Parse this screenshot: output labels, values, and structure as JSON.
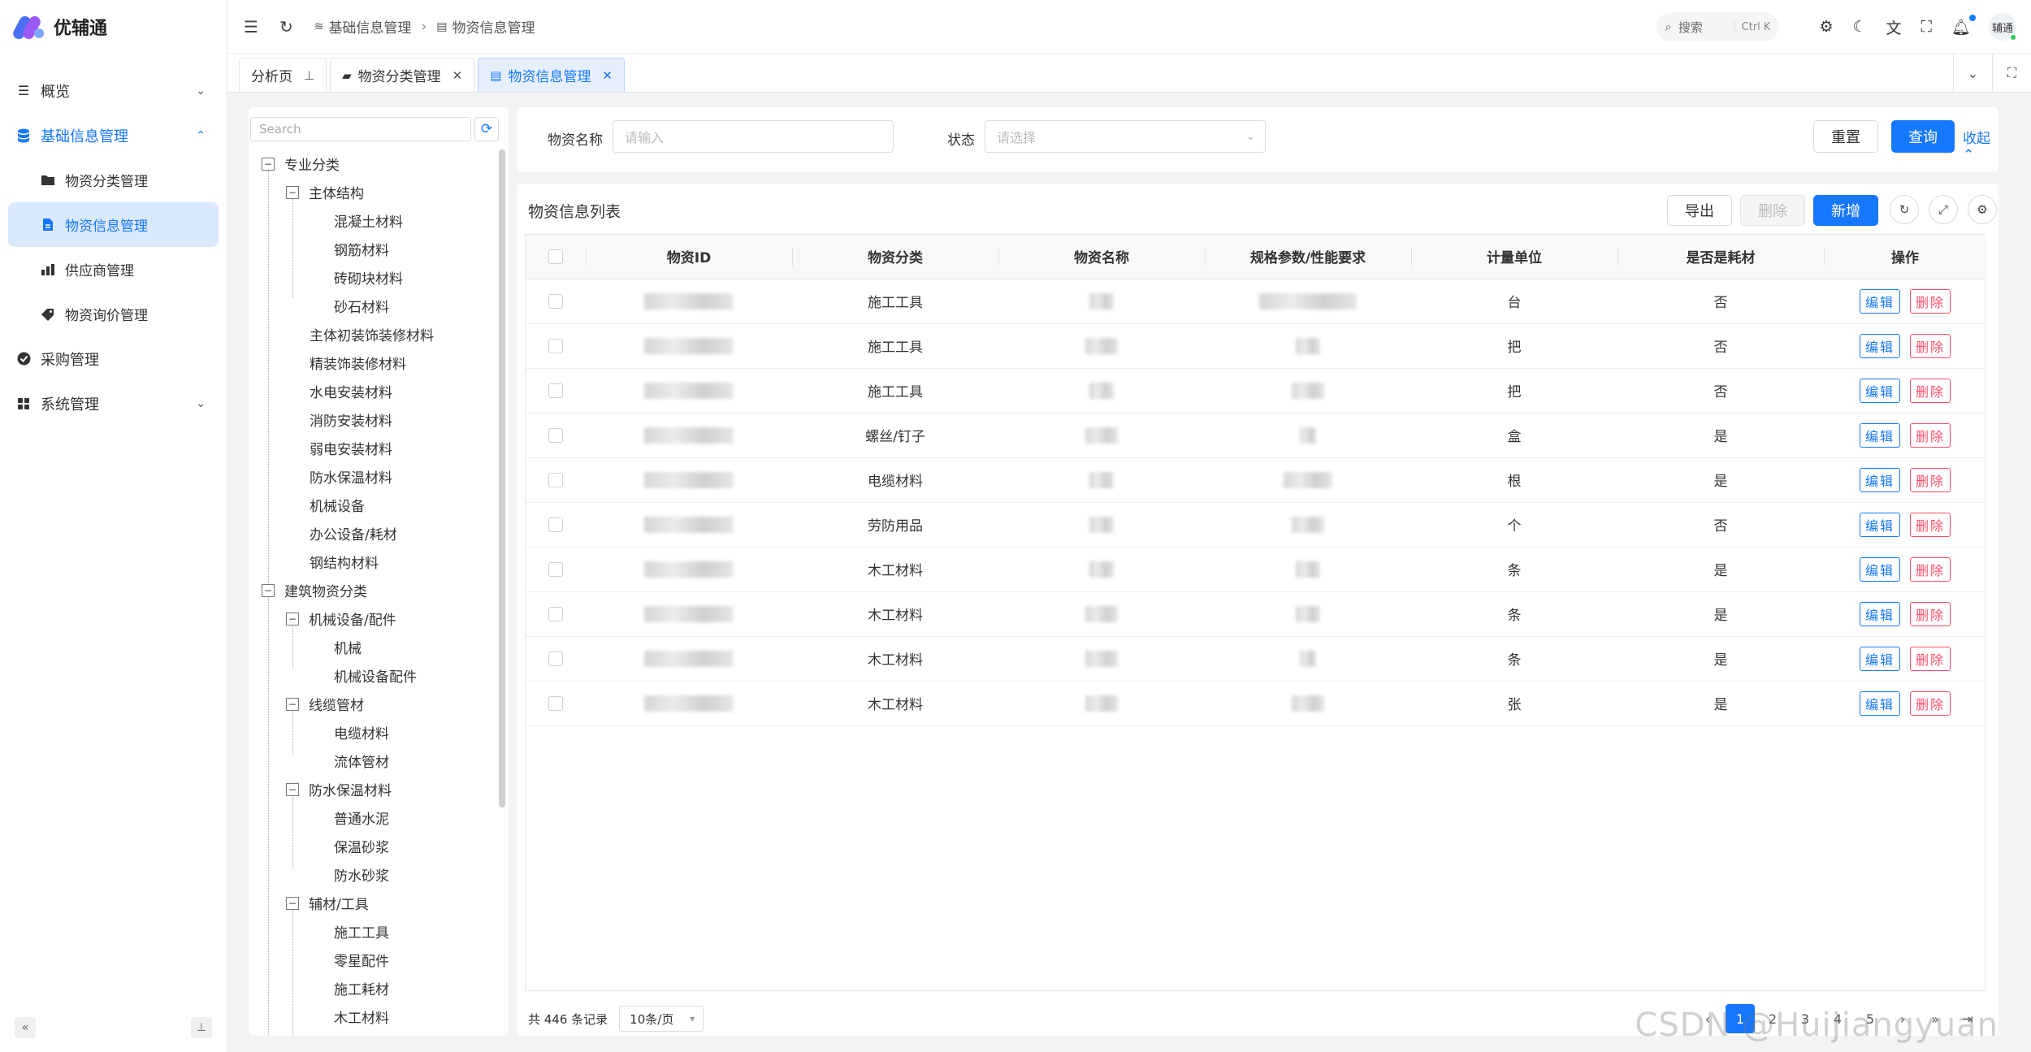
{
  "app": {
    "name": "优辅通"
  },
  "sidebar": {
    "items": [
      {
        "label": "概览",
        "icon": "list-icon"
      },
      {
        "label": "基础信息管理",
        "icon": "database-icon"
      },
      {
        "label": "物资分类管理",
        "icon": "folder-icon"
      },
      {
        "label": "物资信息管理",
        "icon": "file-icon"
      },
      {
        "label": "供应商管理",
        "icon": "chart-icon"
      },
      {
        "label": "物资询价管理",
        "icon": "tag-icon"
      },
      {
        "label": "采购管理",
        "icon": "check-circle-icon"
      },
      {
        "label": "系统管理",
        "icon": "grid-icon"
      }
    ]
  },
  "header": {
    "breadcrumb": [
      "基础信息管理",
      "物资信息管理"
    ],
    "search_label": "搜索",
    "search_shortcut": "Ctrl K",
    "user": "辅通"
  },
  "tabs": [
    {
      "label": "分析页"
    },
    {
      "label": "物资分类管理"
    },
    {
      "label": "物资信息管理"
    }
  ],
  "tree": {
    "search_placeholder": "Search",
    "nodes": [
      "专业分类",
      "主体结构",
      "混凝土材料",
      "钢筋材料",
      "砖砌块材料",
      "砂石材料",
      "主体初装饰装修材料",
      "精装饰装修材料",
      "水电安装材料",
      "消防安装材料",
      "弱电安装材料",
      "防水保温材料",
      "机械设备",
      "办公设备/耗材",
      "钢结构材料",
      "建筑物资分类",
      "机械设备/配件",
      "机械",
      "机械设备配件",
      "线缆管材",
      "电缆材料",
      "流体管材",
      "防水保温材料",
      "普通水泥",
      "保温砂浆",
      "防水砂浆",
      "辅材/工具",
      "施工工具",
      "零星配件",
      "施工耗材",
      "木工材料"
    ]
  },
  "filter": {
    "name_label": "物资名称",
    "name_placeholder": "请输入",
    "status_label": "状态",
    "status_placeholder": "请选择",
    "reset": "重置",
    "query": "查询",
    "collapse": "收起"
  },
  "table": {
    "title": "物资信息列表",
    "export": "导出",
    "delete": "删除",
    "add": "新增",
    "columns": [
      "物资ID",
      "物资分类",
      "物资名称",
      "规格参数/性能要求",
      "计量单位",
      "是否是耗材",
      "操作"
    ],
    "rows": [
      {
        "category": "施工工具",
        "unit": "台",
        "consumable": "否"
      },
      {
        "category": "施工工具",
        "unit": "把",
        "consumable": "否"
      },
      {
        "category": "施工工具",
        "unit": "把",
        "consumable": "否"
      },
      {
        "category": "螺丝/钉子",
        "unit": "盒",
        "consumable": "是"
      },
      {
        "category": "电缆材料",
        "unit": "根",
        "consumable": "是"
      },
      {
        "category": "劳防用品",
        "unit": "个",
        "consumable": "否"
      },
      {
        "category": "木工材料",
        "unit": "条",
        "consumable": "是"
      },
      {
        "category": "木工材料",
        "unit": "条",
        "consumable": "是"
      },
      {
        "category": "木工材料",
        "unit": "条",
        "consumable": "是"
      },
      {
        "category": "木工材料",
        "unit": "张",
        "consumable": "是"
      }
    ],
    "edit_label": "编辑",
    "delete_label": "删除"
  },
  "pagination": {
    "total": "共 446 条记录",
    "page_size": "10条/页",
    "pages": [
      "2",
      "3",
      "4",
      "5"
    ]
  },
  "watermark": "CSDN @Huijiangyuan",
  "colors": {
    "primary": "#1677ff",
    "danger": "#ff4d6a",
    "active_bg": "#dbe9fd"
  }
}
